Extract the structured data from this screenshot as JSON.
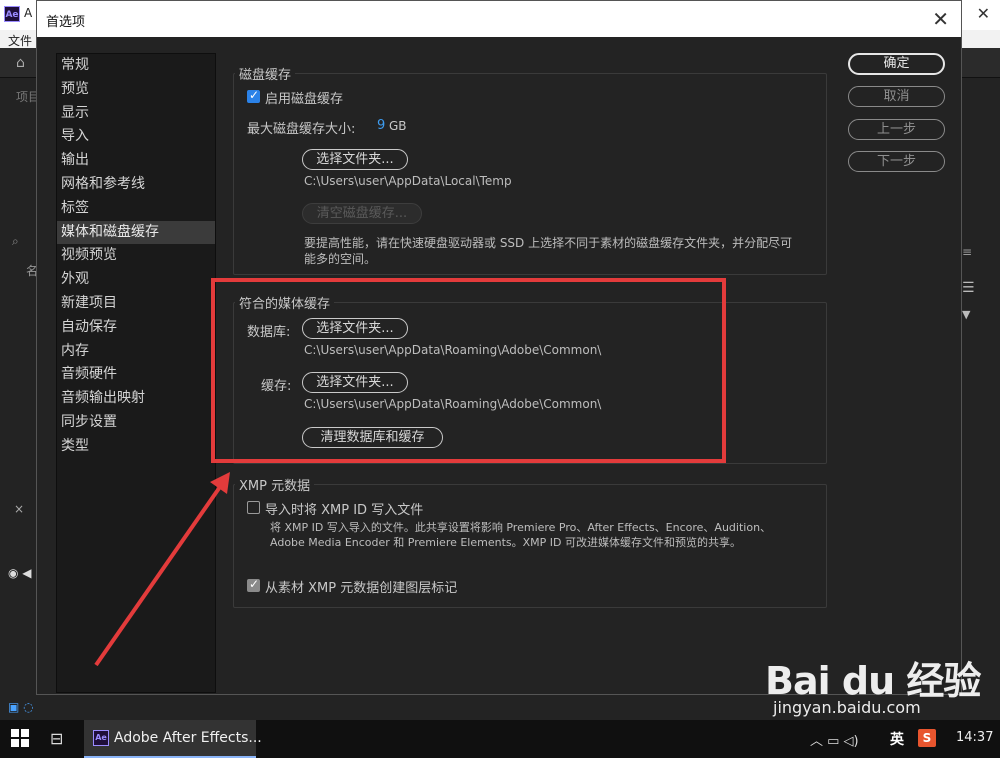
{
  "background_app": {
    "title_initial": "A",
    "menu_file": "文件",
    "project_label": "项目",
    "left_column_label": "名"
  },
  "dialog": {
    "title": "首选项",
    "close_glyph": "✕"
  },
  "nav": {
    "items": [
      "常规",
      "预览",
      "显示",
      "导入",
      "输出",
      "网格和参考线",
      "标签",
      "媒体和磁盘缓存",
      "视频预览",
      "外观",
      "新建项目",
      "自动保存",
      "内存",
      "音频硬件",
      "音频输出映射",
      "同步设置",
      "类型"
    ],
    "active_index": 7
  },
  "actions": {
    "ok": "确定",
    "cancel": "取消",
    "prev": "上一步",
    "next": "下一步"
  },
  "disk_cache": {
    "title": "磁盘缓存",
    "enable_label": "启用磁盘缓存",
    "enable_checked": true,
    "max_size_label": "最大磁盘缓存大小:",
    "max_size_value": "9",
    "max_size_unit": "GB",
    "choose_folder": "选择文件夹...",
    "path": "C:\\Users\\user\\AppData\\Local\\Temp",
    "empty_button": "清空磁盘缓存...",
    "note": "要提高性能，请在快速硬盘驱动器或 SSD 上选择不同于素材的磁盘缓存文件夹，并分配尽可能多的空间。"
  },
  "media_cache": {
    "title": "符合的媒体缓存",
    "database_label": "数据库:",
    "database_button": "选择文件夹...",
    "database_path": "C:\\Users\\user\\AppData\\Roaming\\Adobe\\Common\\",
    "cache_label": "缓存:",
    "cache_button": "选择文件夹...",
    "cache_path": "C:\\Users\\user\\AppData\\Roaming\\Adobe\\Common\\",
    "clean_button": "清理数据库和缓存"
  },
  "xmp": {
    "title": "XMP 元数据",
    "write_id_label": "导入时将 XMP ID 写入文件",
    "write_id_checked": false,
    "desc_line1": "将 XMP ID 写入导入的文件。此共享设置将影响 Premiere Pro、After Effects、Encore、Audition、",
    "desc_line2": "Adobe Media Encoder 和 Premiere Elements。XMP ID 可改进媒体缓存文件和预览的共享。",
    "create_markers_label": "从素材 XMP 元数据创建图层标记",
    "create_markers_checked": true
  },
  "taskbar": {
    "app_label": "Adobe After Effects...",
    "ime": "英",
    "sogou": "S",
    "time": "14:37"
  },
  "watermark": {
    "logo": "Bai du 经验",
    "url": "jingyan.baidu.com"
  },
  "colors": {
    "annotation": "#e33b3b",
    "accent": "#2b82e8",
    "value_blue": "#3d9cf0"
  }
}
